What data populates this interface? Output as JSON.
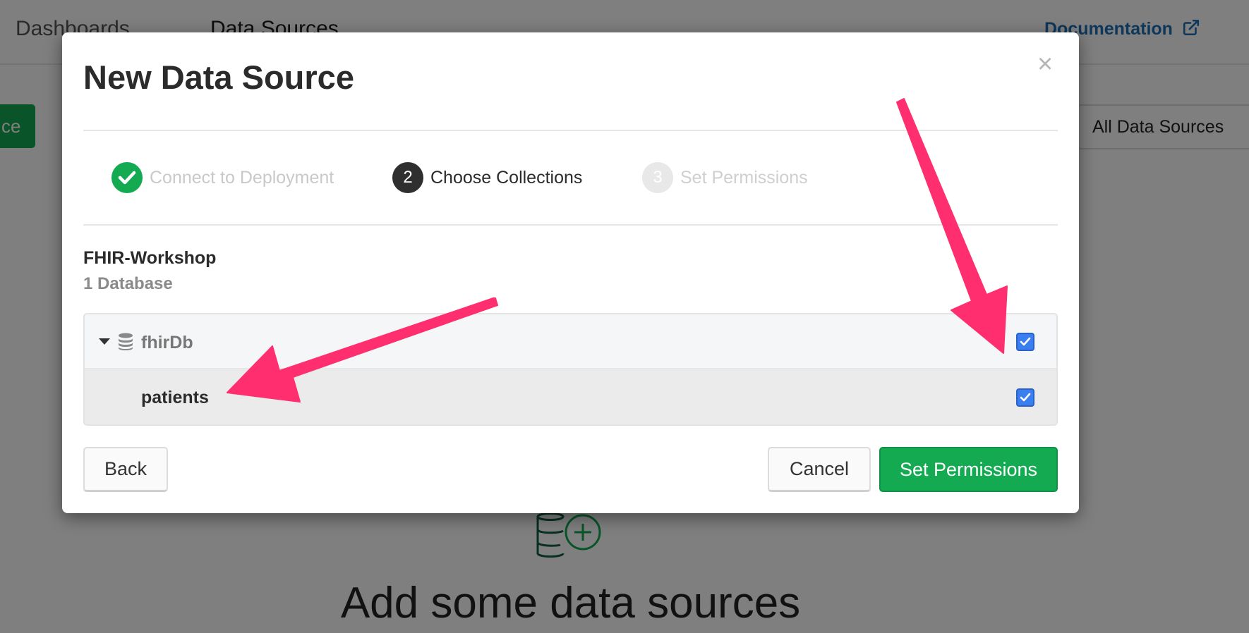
{
  "nav": {
    "dashboards": "Dashboards",
    "data_sources": "Data Sources",
    "documentation": "Documentation"
  },
  "background": {
    "left_button_fragment": "ce",
    "filter_label": "All Data Sources",
    "empty_title": "Add some data sources"
  },
  "modal": {
    "title": "New Data Source",
    "close_glyph": "×",
    "steps": [
      {
        "number": "",
        "label": "Connect to Deployment",
        "state": "done"
      },
      {
        "number": "2",
        "label": "Choose Collections",
        "state": "active"
      },
      {
        "number": "3",
        "label": "Set Permissions",
        "state": "pending"
      }
    ],
    "cluster_name": "FHIR-Workshop",
    "database_count": "1 Database",
    "tree": {
      "database": {
        "name": "fhirDb",
        "checked": true,
        "expanded": true
      },
      "collections": [
        {
          "name": "patients",
          "checked": true
        }
      ]
    },
    "buttons": {
      "back": "Back",
      "cancel": "Cancel",
      "next": "Set Permissions"
    }
  },
  "colors": {
    "primary_green": "#13aa52",
    "checkbox_blue": "#3b7ef0",
    "link_blue": "#1f6fb5",
    "annotation_pink": "#ff2e6e"
  },
  "icons": [
    "external-link-icon",
    "database-plus-icon",
    "checkmark-icon",
    "close-icon",
    "caret-down-icon",
    "database-stack-icon",
    "checkbox-checked-icon",
    "annotation-arrow"
  ]
}
